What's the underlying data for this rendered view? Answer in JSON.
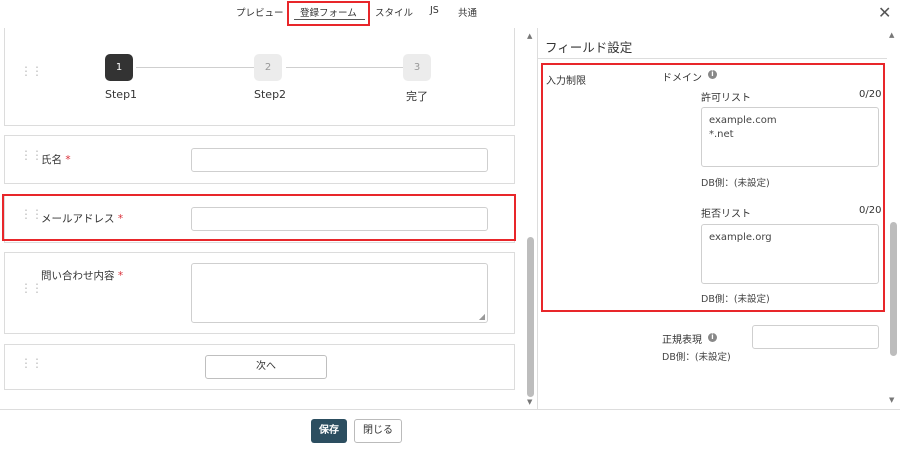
{
  "tabs": [
    {
      "label": "プレビュー"
    },
    {
      "label": "登録フォーム",
      "active": true
    },
    {
      "label": "スタイル"
    },
    {
      "label": "JS"
    },
    {
      "label": "共通"
    }
  ],
  "close_label": "✕",
  "steps": [
    {
      "number": "1",
      "label": "Step1",
      "active": true
    },
    {
      "number": "2",
      "label": "Step2",
      "active": false
    },
    {
      "number": "3",
      "label": "完了",
      "active": false
    }
  ],
  "fields": {
    "name": {
      "label": "氏名",
      "required_mark": "*",
      "value": ""
    },
    "email": {
      "label": "メールアドレス",
      "required_mark": "*",
      "value": ""
    },
    "inquiry": {
      "label": "問い合わせ内容",
      "required_mark": "*",
      "value": ""
    }
  },
  "next_button": "次へ",
  "field_settings": {
    "title": "フィールド設定",
    "input_restriction_label": "入力制限",
    "domain_label": "ドメイン",
    "allow_list": {
      "label": "許可リスト",
      "count": "0/20",
      "value": "example.com\n*.net",
      "db_side": "DB側：(未設定)"
    },
    "deny_list": {
      "label": "拒否リスト",
      "count": "0/20",
      "value": "example.org",
      "db_side": "DB側：(未設定)"
    },
    "regex": {
      "label": "正規表現",
      "value": "",
      "db_side": "DB側：(未設定)"
    }
  },
  "footer": {
    "save": "保存",
    "close": "閉じる"
  },
  "colors": {
    "highlight": "#e8262a",
    "save_button": "#2c4e60",
    "step_active": "#333333"
  }
}
